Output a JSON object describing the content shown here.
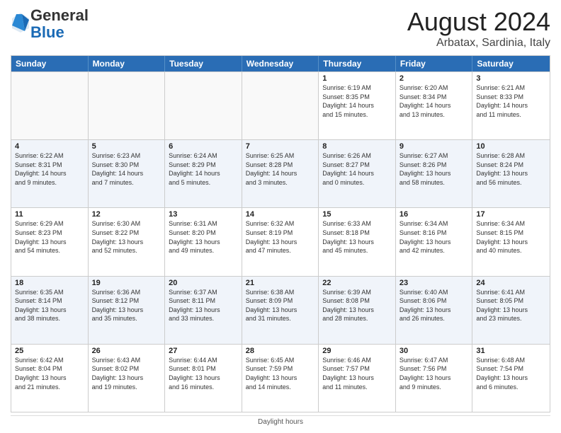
{
  "header": {
    "logo_general": "General",
    "logo_blue": "Blue",
    "month_year": "August 2024",
    "location": "Arbatax, Sardinia, Italy"
  },
  "days_of_week": [
    "Sunday",
    "Monday",
    "Tuesday",
    "Wednesday",
    "Thursday",
    "Friday",
    "Saturday"
  ],
  "rows": [
    [
      {
        "day": "",
        "info": ""
      },
      {
        "day": "",
        "info": ""
      },
      {
        "day": "",
        "info": ""
      },
      {
        "day": "",
        "info": ""
      },
      {
        "day": "1",
        "info": "Sunrise: 6:19 AM\nSunset: 8:35 PM\nDaylight: 14 hours\nand 15 minutes."
      },
      {
        "day": "2",
        "info": "Sunrise: 6:20 AM\nSunset: 8:34 PM\nDaylight: 14 hours\nand 13 minutes."
      },
      {
        "day": "3",
        "info": "Sunrise: 6:21 AM\nSunset: 8:33 PM\nDaylight: 14 hours\nand 11 minutes."
      }
    ],
    [
      {
        "day": "4",
        "info": "Sunrise: 6:22 AM\nSunset: 8:31 PM\nDaylight: 14 hours\nand 9 minutes."
      },
      {
        "day": "5",
        "info": "Sunrise: 6:23 AM\nSunset: 8:30 PM\nDaylight: 14 hours\nand 7 minutes."
      },
      {
        "day": "6",
        "info": "Sunrise: 6:24 AM\nSunset: 8:29 PM\nDaylight: 14 hours\nand 5 minutes."
      },
      {
        "day": "7",
        "info": "Sunrise: 6:25 AM\nSunset: 8:28 PM\nDaylight: 14 hours\nand 3 minutes."
      },
      {
        "day": "8",
        "info": "Sunrise: 6:26 AM\nSunset: 8:27 PM\nDaylight: 14 hours\nand 0 minutes."
      },
      {
        "day": "9",
        "info": "Sunrise: 6:27 AM\nSunset: 8:26 PM\nDaylight: 13 hours\nand 58 minutes."
      },
      {
        "day": "10",
        "info": "Sunrise: 6:28 AM\nSunset: 8:24 PM\nDaylight: 13 hours\nand 56 minutes."
      }
    ],
    [
      {
        "day": "11",
        "info": "Sunrise: 6:29 AM\nSunset: 8:23 PM\nDaylight: 13 hours\nand 54 minutes."
      },
      {
        "day": "12",
        "info": "Sunrise: 6:30 AM\nSunset: 8:22 PM\nDaylight: 13 hours\nand 52 minutes."
      },
      {
        "day": "13",
        "info": "Sunrise: 6:31 AM\nSunset: 8:20 PM\nDaylight: 13 hours\nand 49 minutes."
      },
      {
        "day": "14",
        "info": "Sunrise: 6:32 AM\nSunset: 8:19 PM\nDaylight: 13 hours\nand 47 minutes."
      },
      {
        "day": "15",
        "info": "Sunrise: 6:33 AM\nSunset: 8:18 PM\nDaylight: 13 hours\nand 45 minutes."
      },
      {
        "day": "16",
        "info": "Sunrise: 6:34 AM\nSunset: 8:16 PM\nDaylight: 13 hours\nand 42 minutes."
      },
      {
        "day": "17",
        "info": "Sunrise: 6:34 AM\nSunset: 8:15 PM\nDaylight: 13 hours\nand 40 minutes."
      }
    ],
    [
      {
        "day": "18",
        "info": "Sunrise: 6:35 AM\nSunset: 8:14 PM\nDaylight: 13 hours\nand 38 minutes."
      },
      {
        "day": "19",
        "info": "Sunrise: 6:36 AM\nSunset: 8:12 PM\nDaylight: 13 hours\nand 35 minutes."
      },
      {
        "day": "20",
        "info": "Sunrise: 6:37 AM\nSunset: 8:11 PM\nDaylight: 13 hours\nand 33 minutes."
      },
      {
        "day": "21",
        "info": "Sunrise: 6:38 AM\nSunset: 8:09 PM\nDaylight: 13 hours\nand 31 minutes."
      },
      {
        "day": "22",
        "info": "Sunrise: 6:39 AM\nSunset: 8:08 PM\nDaylight: 13 hours\nand 28 minutes."
      },
      {
        "day": "23",
        "info": "Sunrise: 6:40 AM\nSunset: 8:06 PM\nDaylight: 13 hours\nand 26 minutes."
      },
      {
        "day": "24",
        "info": "Sunrise: 6:41 AM\nSunset: 8:05 PM\nDaylight: 13 hours\nand 23 minutes."
      }
    ],
    [
      {
        "day": "25",
        "info": "Sunrise: 6:42 AM\nSunset: 8:04 PM\nDaylight: 13 hours\nand 21 minutes."
      },
      {
        "day": "26",
        "info": "Sunrise: 6:43 AM\nSunset: 8:02 PM\nDaylight: 13 hours\nand 19 minutes."
      },
      {
        "day": "27",
        "info": "Sunrise: 6:44 AM\nSunset: 8:01 PM\nDaylight: 13 hours\nand 16 minutes."
      },
      {
        "day": "28",
        "info": "Sunrise: 6:45 AM\nSunset: 7:59 PM\nDaylight: 13 hours\nand 14 minutes."
      },
      {
        "day": "29",
        "info": "Sunrise: 6:46 AM\nSunset: 7:57 PM\nDaylight: 13 hours\nand 11 minutes."
      },
      {
        "day": "30",
        "info": "Sunrise: 6:47 AM\nSunset: 7:56 PM\nDaylight: 13 hours\nand 9 minutes."
      },
      {
        "day": "31",
        "info": "Sunrise: 6:48 AM\nSunset: 7:54 PM\nDaylight: 13 hours\nand 6 minutes."
      }
    ]
  ],
  "footer": {
    "daylight_label": "Daylight hours"
  }
}
